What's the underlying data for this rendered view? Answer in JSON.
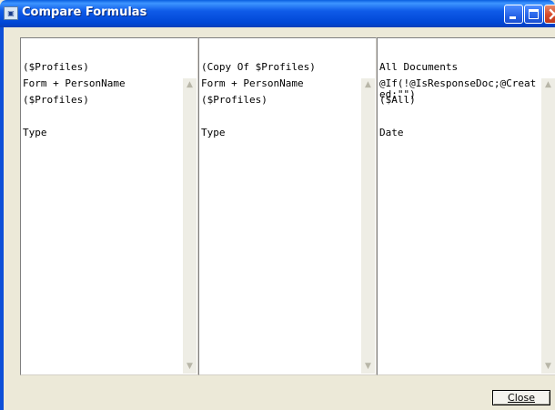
{
  "window": {
    "title": "Compare Formulas",
    "icon": "app-icon"
  },
  "panels": [
    {
      "header": [
        "($Profiles)",
        "($Profiles)",
        "Type"
      ],
      "formula": "Form + PersonName"
    },
    {
      "header": [
        "(Copy Of $Profiles)",
        "($Profiles)",
        "Type"
      ],
      "formula": "Form + PersonName"
    },
    {
      "header": [
        "All Documents",
        "($All)",
        "Date"
      ],
      "formula": "@If(!@IsResponseDoc;@Created;\"\")"
    }
  ],
  "buttons": {
    "close_label": "Close"
  },
  "colors": {
    "titlebar": "#0046d5",
    "dialog_bg": "#ece9d8",
    "close_button": "#d6492a"
  }
}
